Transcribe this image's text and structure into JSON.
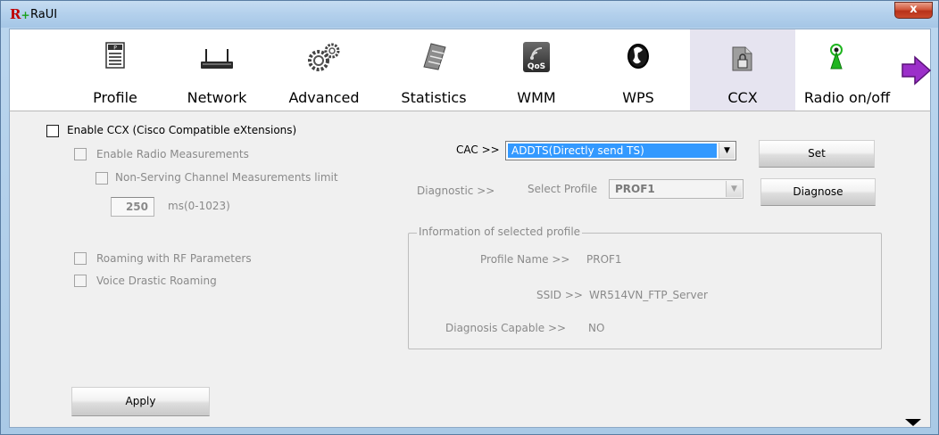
{
  "window": {
    "logo": "R",
    "logo_plus": "+",
    "title": "RaUI",
    "close": "x"
  },
  "toolbar": {
    "items": [
      {
        "label": "Profile",
        "icon": "profile-icon"
      },
      {
        "label": "Network",
        "icon": "network-icon"
      },
      {
        "label": "Advanced",
        "icon": "gears-icon"
      },
      {
        "label": "Statistics",
        "icon": "statistics-icon"
      },
      {
        "label": "WMM",
        "icon": "qos-icon"
      },
      {
        "label": "WPS",
        "icon": "wps-icon"
      },
      {
        "label": "CCX",
        "icon": "ccx-icon"
      },
      {
        "label": "Radio on/off",
        "icon": "radio-antenna-icon"
      }
    ],
    "active": "CCX",
    "wmm_icon_text": "QoS",
    "next_icon": "arrow-right-icon"
  },
  "ccx": {
    "enable_ccx": "Enable CCX (Cisco Compatible eXtensions)",
    "enable_radio_measurements": "Enable Radio Measurements",
    "non_serving_limit": "Non-Serving Channel Measurements limit",
    "limit_value": "250",
    "limit_unit": "ms(0-1023)",
    "roaming_rf": "Roaming with RF Parameters",
    "voice_drastic_roaming": "Voice Drastic Roaming",
    "apply": "Apply",
    "cac_label": "CAC >>",
    "cac_value": "ADDTS(Directly send TS)",
    "set": "Set",
    "diagnostic_label": "Diagnostic >>",
    "select_profile_label": "Select Profile",
    "profile_value": "PROF1",
    "diagnose": "Diagnose",
    "info_legend": "Information of selected profile",
    "profile_name_label": "Profile Name >>",
    "profile_name_value": "PROF1",
    "ssid_label": "SSID >>",
    "ssid_value": "WR514VN_FTP_Server",
    "diag_capable_label": "Diagnosis Capable >>",
    "diag_capable_value": "NO"
  },
  "colors": {
    "selection": "#3399ff",
    "active_tab": "#e6e4f0",
    "arrow_purple": "#9b2fc9",
    "antenna_green": "#1fb51f"
  }
}
